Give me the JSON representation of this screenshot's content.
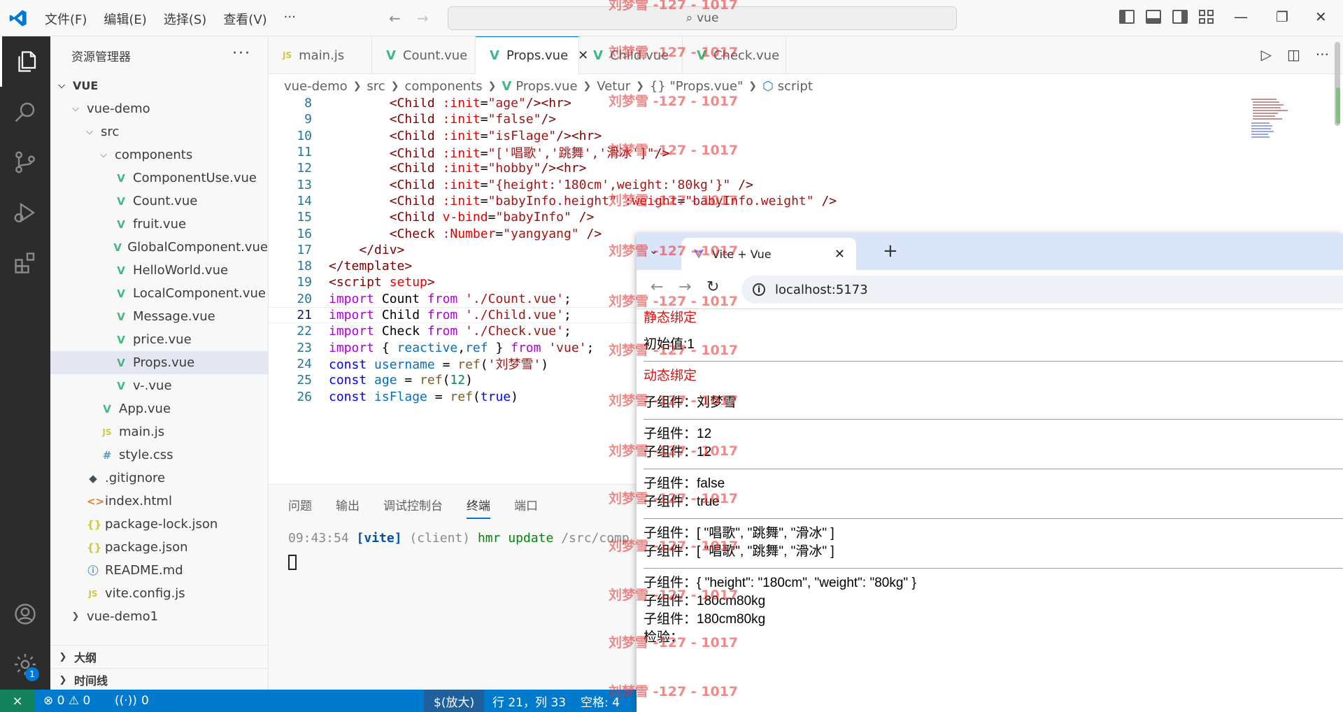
{
  "titlebar": {
    "menu": [
      "文件(F)",
      "编辑(E)",
      "选择(S)",
      "查看(V)",
      "···"
    ],
    "search": "vue"
  },
  "sidebar": {
    "title": "资源管理器",
    "more": "···",
    "tree": [
      {
        "label": "VUE",
        "level": 0,
        "chev": "open",
        "icon": "",
        "bold": true
      },
      {
        "label": "vue-demo",
        "level": 1,
        "chev": "open",
        "icon": ""
      },
      {
        "label": "src",
        "level": 2,
        "chev": "open",
        "icon": ""
      },
      {
        "label": "components",
        "level": 3,
        "chev": "open",
        "icon": ""
      },
      {
        "label": "ComponentUse.vue",
        "level": 4,
        "icon": "vue"
      },
      {
        "label": "Count.vue",
        "level": 4,
        "icon": "vue"
      },
      {
        "label": "fruit.vue",
        "level": 4,
        "icon": "vue"
      },
      {
        "label": "GlobalComponent.vue",
        "level": 4,
        "icon": "vue"
      },
      {
        "label": "HelloWorld.vue",
        "level": 4,
        "icon": "vue"
      },
      {
        "label": "LocalComponent.vue",
        "level": 4,
        "icon": "vue"
      },
      {
        "label": "Message.vue",
        "level": 4,
        "icon": "vue"
      },
      {
        "label": "price.vue",
        "level": 4,
        "icon": "vue"
      },
      {
        "label": "Props.vue",
        "level": 4,
        "icon": "vue",
        "selected": true
      },
      {
        "label": "v-.vue",
        "level": 4,
        "icon": "vue"
      },
      {
        "label": "App.vue",
        "level": 3,
        "icon": "vue"
      },
      {
        "label": "main.js",
        "level": 3,
        "icon": "js"
      },
      {
        "label": "style.css",
        "level": 3,
        "icon": "css"
      },
      {
        "label": ".gitignore",
        "level": 2,
        "icon": "git"
      },
      {
        "label": "index.html",
        "level": 2,
        "icon": "html"
      },
      {
        "label": "package-lock.json",
        "level": 2,
        "icon": "json"
      },
      {
        "label": "package.json",
        "level": 2,
        "icon": "json"
      },
      {
        "label": "README.md",
        "level": 2,
        "icon": "info"
      },
      {
        "label": "vite.config.js",
        "level": 2,
        "icon": "js"
      },
      {
        "label": "vue-demo1",
        "level": 1,
        "chev": "closed",
        "icon": ""
      }
    ],
    "outline": "大纲",
    "timeline": "时间线"
  },
  "activity": {
    "badge": "1"
  },
  "tabs": [
    {
      "label": "main.js",
      "icon": "js"
    },
    {
      "label": "Count.vue",
      "icon": "vue"
    },
    {
      "label": "Props.vue",
      "icon": "vue",
      "active": true
    },
    {
      "label": "Child.vue",
      "icon": "vue"
    },
    {
      "label": "Check.vue",
      "icon": "vue"
    }
  ],
  "breadcrumb": [
    "vue-demo",
    "src",
    "components",
    "Props.vue",
    "Vetur",
    "{} \"Props.vue\"",
    "script"
  ],
  "code": [
    {
      "n": "8",
      "tokens": [
        [
          "        ",
          ""
        ],
        [
          "<Child ",
          "tg"
        ],
        [
          ":init",
          "at"
        ],
        [
          "=",
          ""
        ],
        [
          "\"age\"",
          "st"
        ],
        [
          "/><hr>",
          "tg"
        ]
      ]
    },
    {
      "n": "9",
      "tokens": [
        [
          "        ",
          ""
        ],
        [
          "<Child ",
          "tg"
        ],
        [
          ":init",
          "at"
        ],
        [
          "=",
          ""
        ],
        [
          "\"false\"",
          "st"
        ],
        [
          "/>",
          "tg"
        ]
      ]
    },
    {
      "n": "10",
      "tokens": [
        [
          "        ",
          ""
        ],
        [
          "<Child ",
          "tg"
        ],
        [
          ":init",
          "at"
        ],
        [
          "=",
          ""
        ],
        [
          "\"isFlage\"",
          "st"
        ],
        [
          "/><hr>",
          "tg"
        ]
      ]
    },
    {
      "n": "11",
      "tokens": [
        [
          "        ",
          ""
        ],
        [
          "<Child ",
          "tg"
        ],
        [
          ":init",
          "at"
        ],
        [
          "=",
          ""
        ],
        [
          "\"['唱歌','跳舞','滑冰']\"",
          "st"
        ],
        [
          "/>",
          "tg"
        ]
      ]
    },
    {
      "n": "12",
      "tokens": [
        [
          "        ",
          ""
        ],
        [
          "<Child ",
          "tg"
        ],
        [
          ":init",
          "at"
        ],
        [
          "=",
          ""
        ],
        [
          "\"hobby\"",
          "st"
        ],
        [
          "/><hr>",
          "tg"
        ]
      ]
    },
    {
      "n": "13",
      "tokens": [
        [
          "        ",
          ""
        ],
        [
          "<Child ",
          "tg"
        ],
        [
          ":init",
          "at"
        ],
        [
          "=",
          ""
        ],
        [
          "\"{height:'180cm',weight:'80kg'}\"",
          "st"
        ],
        [
          " />",
          "tg"
        ]
      ]
    },
    {
      "n": "14",
      "tokens": [
        [
          "        ",
          ""
        ],
        [
          "<Child ",
          "tg"
        ],
        [
          ":init",
          "at"
        ],
        [
          "=",
          ""
        ],
        [
          "\"babyInfo.height\"",
          "st"
        ],
        [
          " ",
          ""
        ],
        [
          ":weight",
          "at"
        ],
        [
          "=",
          ""
        ],
        [
          "\"babyInfo.weight\"",
          "st"
        ],
        [
          " />",
          "tg"
        ]
      ]
    },
    {
      "n": "15",
      "tokens": [
        [
          "        ",
          ""
        ],
        [
          "<Child ",
          "tg"
        ],
        [
          "v-bind",
          "at"
        ],
        [
          "=",
          ""
        ],
        [
          "\"babyInfo\"",
          "st"
        ],
        [
          " />",
          "tg"
        ]
      ]
    },
    {
      "n": "16",
      "tokens": [
        [
          "        ",
          ""
        ],
        [
          "<Check ",
          "tg"
        ],
        [
          ":Number",
          "at"
        ],
        [
          "=",
          ""
        ],
        [
          "\"yangyang\"",
          "st"
        ],
        [
          " />",
          "tg"
        ]
      ]
    },
    {
      "n": "17",
      "tokens": [
        [
          "    ",
          ""
        ],
        [
          "</div>",
          "tg"
        ]
      ]
    },
    {
      "n": "18",
      "tokens": [
        [
          "",
          ""
        ],
        [
          "</template>",
          "tg"
        ]
      ]
    },
    {
      "n": "19",
      "tokens": [
        [
          "",
          ""
        ],
        [
          "<script ",
          "tg"
        ],
        [
          "setup",
          "at"
        ],
        [
          ">",
          "tg"
        ]
      ]
    },
    {
      "n": "20",
      "tokens": [
        [
          "",
          ""
        ],
        [
          "import",
          "kc"
        ],
        [
          " Count ",
          ""
        ],
        [
          "from",
          "kc"
        ],
        [
          " ",
          ""
        ],
        [
          "'./Count.vue'",
          "st"
        ],
        [
          ";",
          ""
        ]
      ]
    },
    {
      "n": "21",
      "cur": true,
      "tokens": [
        [
          "",
          ""
        ],
        [
          "import",
          "kc"
        ],
        [
          " Child ",
          ""
        ],
        [
          "from",
          "kc"
        ],
        [
          " ",
          ""
        ],
        [
          "'./Child.vue'",
          "st"
        ],
        [
          ";",
          ""
        ]
      ]
    },
    {
      "n": "22",
      "tokens": [
        [
          "",
          ""
        ],
        [
          "import",
          "kc"
        ],
        [
          " Check ",
          ""
        ],
        [
          "from",
          "kc"
        ],
        [
          " ",
          ""
        ],
        [
          "'./Check.vue'",
          "st"
        ],
        [
          ";",
          ""
        ]
      ]
    },
    {
      "n": "23",
      "tokens": [
        [
          "",
          ""
        ],
        [
          "import",
          "kc"
        ],
        [
          " { ",
          ""
        ],
        [
          "reactive",
          "vr"
        ],
        [
          ",",
          ""
        ],
        [
          "ref",
          "vr"
        ],
        [
          " } ",
          ""
        ],
        [
          "from",
          "kc"
        ],
        [
          " ",
          ""
        ],
        [
          "'vue'",
          "st"
        ],
        [
          ";",
          ""
        ]
      ]
    },
    {
      "n": "24",
      "tokens": [
        [
          "",
          ""
        ],
        [
          "const",
          "kw"
        ],
        [
          " ",
          ""
        ],
        [
          "username",
          "vr"
        ],
        [
          " = ",
          ""
        ],
        [
          "ref",
          "fn"
        ],
        [
          "(",
          ""
        ],
        [
          "'刘梦雪'",
          "st"
        ],
        [
          ")",
          ""
        ]
      ]
    },
    {
      "n": "25",
      "tokens": [
        [
          "",
          ""
        ],
        [
          "const",
          "kw"
        ],
        [
          " ",
          ""
        ],
        [
          "age",
          "vr"
        ],
        [
          " = ",
          ""
        ],
        [
          "ref",
          "fn"
        ],
        [
          "(",
          ""
        ],
        [
          "12",
          "nm"
        ],
        [
          ")",
          ""
        ]
      ]
    },
    {
      "n": "26",
      "tokens": [
        [
          "",
          ""
        ],
        [
          "const",
          "kw"
        ],
        [
          " ",
          ""
        ],
        [
          "isFlage",
          "vr"
        ],
        [
          " = ",
          ""
        ],
        [
          "ref",
          "fn"
        ],
        [
          "(",
          ""
        ],
        [
          "true",
          "kw"
        ],
        [
          ")",
          ""
        ]
      ]
    }
  ],
  "panel": {
    "tabs": [
      "问题",
      "输出",
      "调试控制台",
      "终端",
      "端口"
    ],
    "active": "终端",
    "term_time": "09:43:54",
    "term_vite": "[vite]",
    "term_client": "(client)",
    "term_hmr": "hmr update",
    "term_path": "/src/comp"
  },
  "statusbar": {
    "errors": "⊗ 0 ⚠ 0",
    "ports": "0",
    "mode": "$(放大)",
    "position": "行 21，列 33",
    "spaces": "空格: 4"
  },
  "browser": {
    "tab_title": "Vite + Vue",
    "url": "localhost:5173",
    "lines": [
      {
        "t": "静态绑定",
        "h": true
      },
      {
        "t": "初始值:1"
      },
      {
        "hr": true
      },
      {
        "t": "动态绑定",
        "h": true
      },
      {
        "t": "子组件：刘梦雪"
      },
      {
        "hr": true
      },
      {
        "t": "子组件：12"
      },
      {
        "t": "子组件：12"
      },
      {
        "hr": true
      },
      {
        "t": "子组件：false"
      },
      {
        "t": "子组件：true"
      },
      {
        "hr": true
      },
      {
        "t": "子组件：[ \"唱歌\", \"跳舞\", \"滑冰\" ]"
      },
      {
        "t": "子组件：[ \"唱歌\", \"跳舞\", \"滑冰\" ]"
      },
      {
        "hr": true
      },
      {
        "t": "子组件：{ \"height\": \"180cm\", \"weight\": \"80kg\" }"
      },
      {
        "t": "子组件：180cm80kg"
      },
      {
        "t": "子组件：180cm80kg"
      },
      {
        "t": "检验："
      }
    ]
  },
  "watermark": "刘梦雪 -127 - 1017"
}
